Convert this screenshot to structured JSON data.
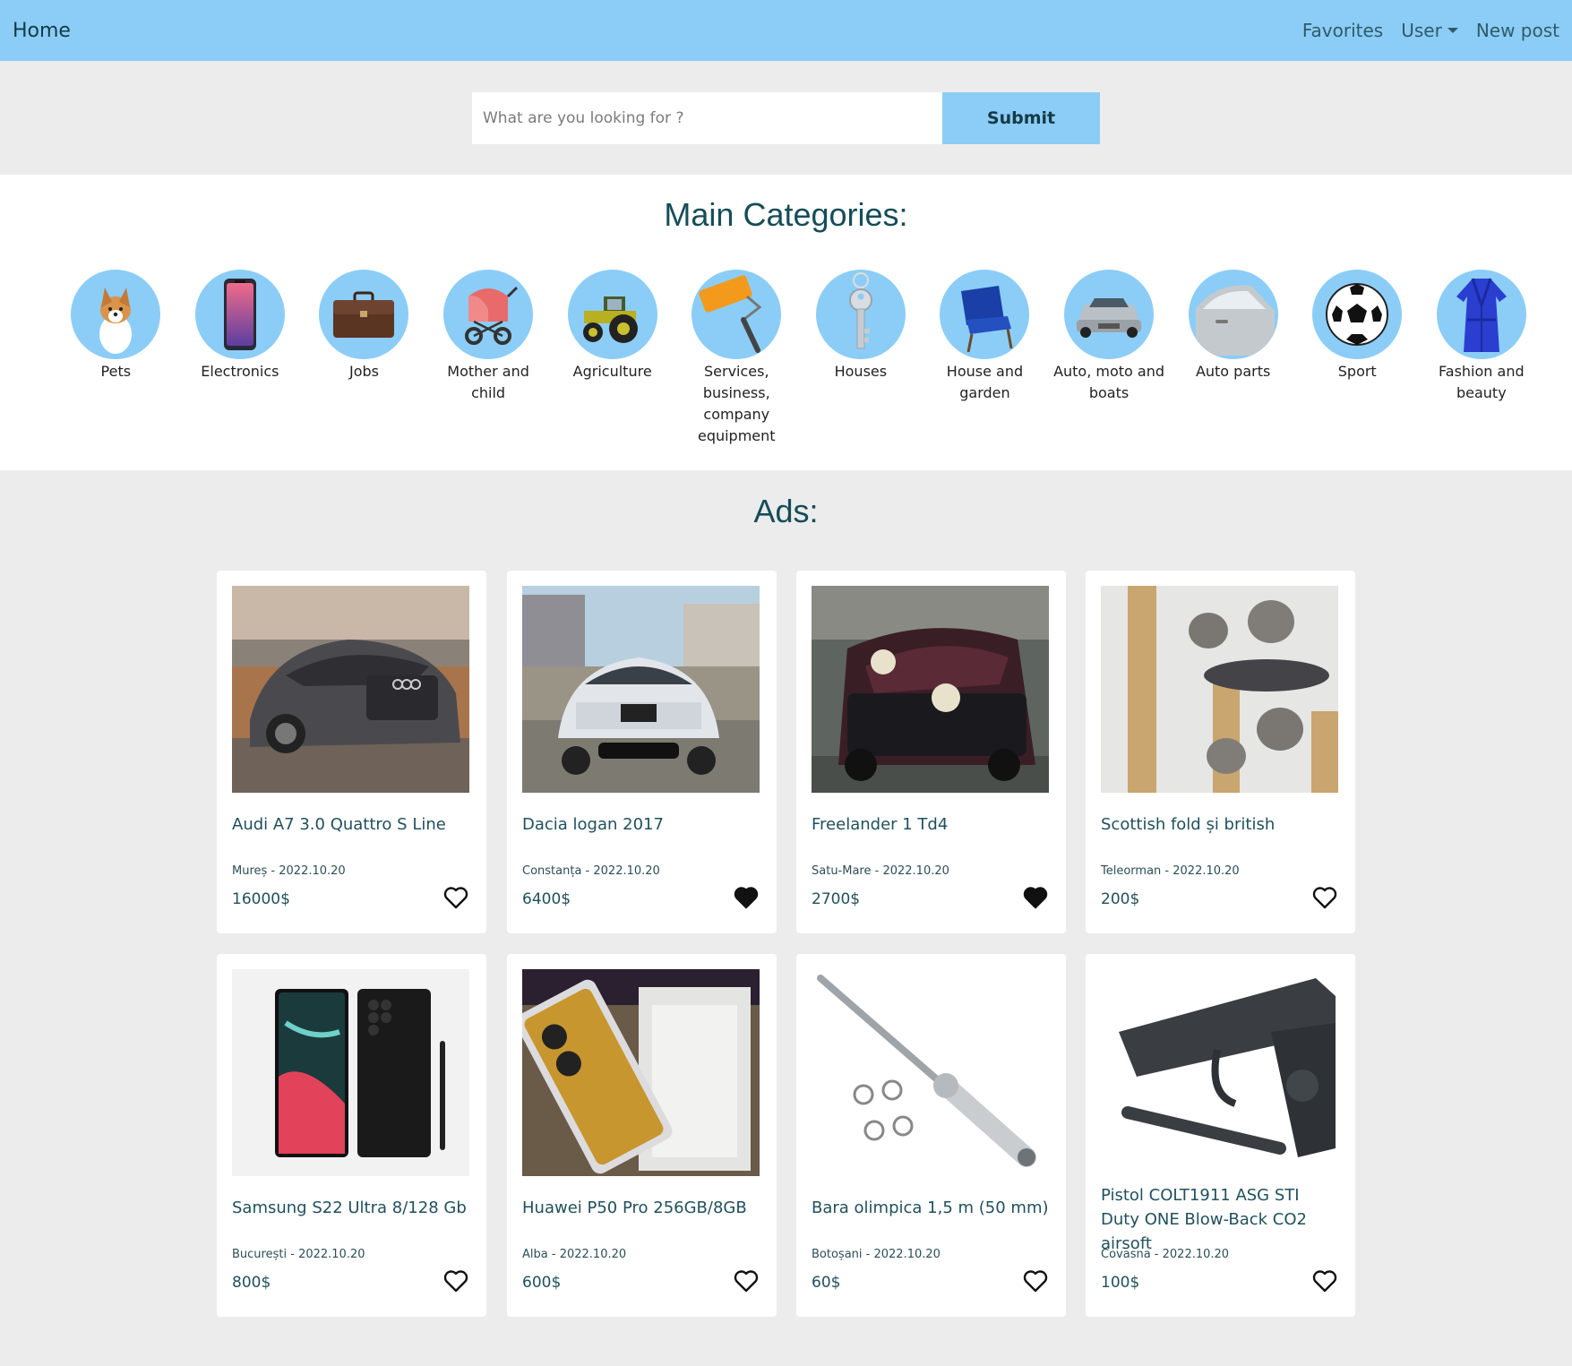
{
  "navbar": {
    "brand": "Home",
    "favorites": "Favorites",
    "user": "User",
    "new_post": "New post"
  },
  "search": {
    "placeholder": "What are you looking for ?",
    "submit_label": "Submit"
  },
  "categories": {
    "title": "Main Categories:",
    "items": [
      {
        "label": "Pets",
        "icon": "dog-icon"
      },
      {
        "label": "Electronics",
        "icon": "smartphone-icon"
      },
      {
        "label": "Jobs",
        "icon": "briefcase-icon"
      },
      {
        "label": "Mother and child",
        "icon": "stroller-icon"
      },
      {
        "label": "Agriculture",
        "icon": "tractor-icon"
      },
      {
        "label": "Services, business, company equipment",
        "icon": "paint-roller-icon"
      },
      {
        "label": "Houses",
        "icon": "key-icon"
      },
      {
        "label": "House and garden",
        "icon": "armchair-icon"
      },
      {
        "label": "Auto, moto and boats",
        "icon": "car-icon"
      },
      {
        "label": "Auto parts",
        "icon": "car-door-icon"
      },
      {
        "label": "Sport",
        "icon": "soccer-ball-icon"
      },
      {
        "label": "Fashion and beauty",
        "icon": "robe-icon"
      }
    ]
  },
  "ads": {
    "title": "Ads:",
    "items": [
      {
        "title": "Audi A7 3.0 Quattro S Line",
        "location": "Mureș",
        "date": "2022.10.20",
        "price": "16000$",
        "favorited": false,
        "image": "grey-sedan-photo"
      },
      {
        "title": "Dacia logan 2017",
        "location": "Constanța",
        "date": "2022.10.20",
        "price": "6400$",
        "favorited": true,
        "image": "white-sedan-photo"
      },
      {
        "title": "Freelander 1 Td4",
        "location": "Satu-Mare",
        "date": "2022.10.20",
        "price": "2700$",
        "favorited": true,
        "image": "red-suv-photo"
      },
      {
        "title": "Scottish fold și british",
        "location": "Teleorman",
        "date": "2022.10.20",
        "price": "200$",
        "favorited": false,
        "image": "kittens-photo"
      },
      {
        "title": "Samsung S22 Ultra 8/128 Gb",
        "location": "București",
        "date": "2022.10.20",
        "price": "800$",
        "favorited": false,
        "image": "smartphone-photo"
      },
      {
        "title": "Huawei P50 Pro 256GB/8GB",
        "location": "Alba",
        "date": "2022.10.20",
        "price": "600$",
        "favorited": false,
        "image": "phone-box-photo"
      },
      {
        "title": "Bara olimpica 1,5 m (50 mm)",
        "location": "Botoșani",
        "date": "2022.10.20",
        "price": "60$",
        "favorited": false,
        "image": "barbell-photo"
      },
      {
        "title": "Pistol COLT1911 ASG STI Duty ONE Blow-Back CO2 airsoft",
        "location": "Covasna",
        "date": "2022.10.20",
        "price": "100$",
        "favorited": false,
        "image": "pistol-photo"
      }
    ]
  },
  "colors": {
    "accent": "#8bcdf7",
    "heading": "#154d58",
    "page_bg": "#ececec"
  }
}
